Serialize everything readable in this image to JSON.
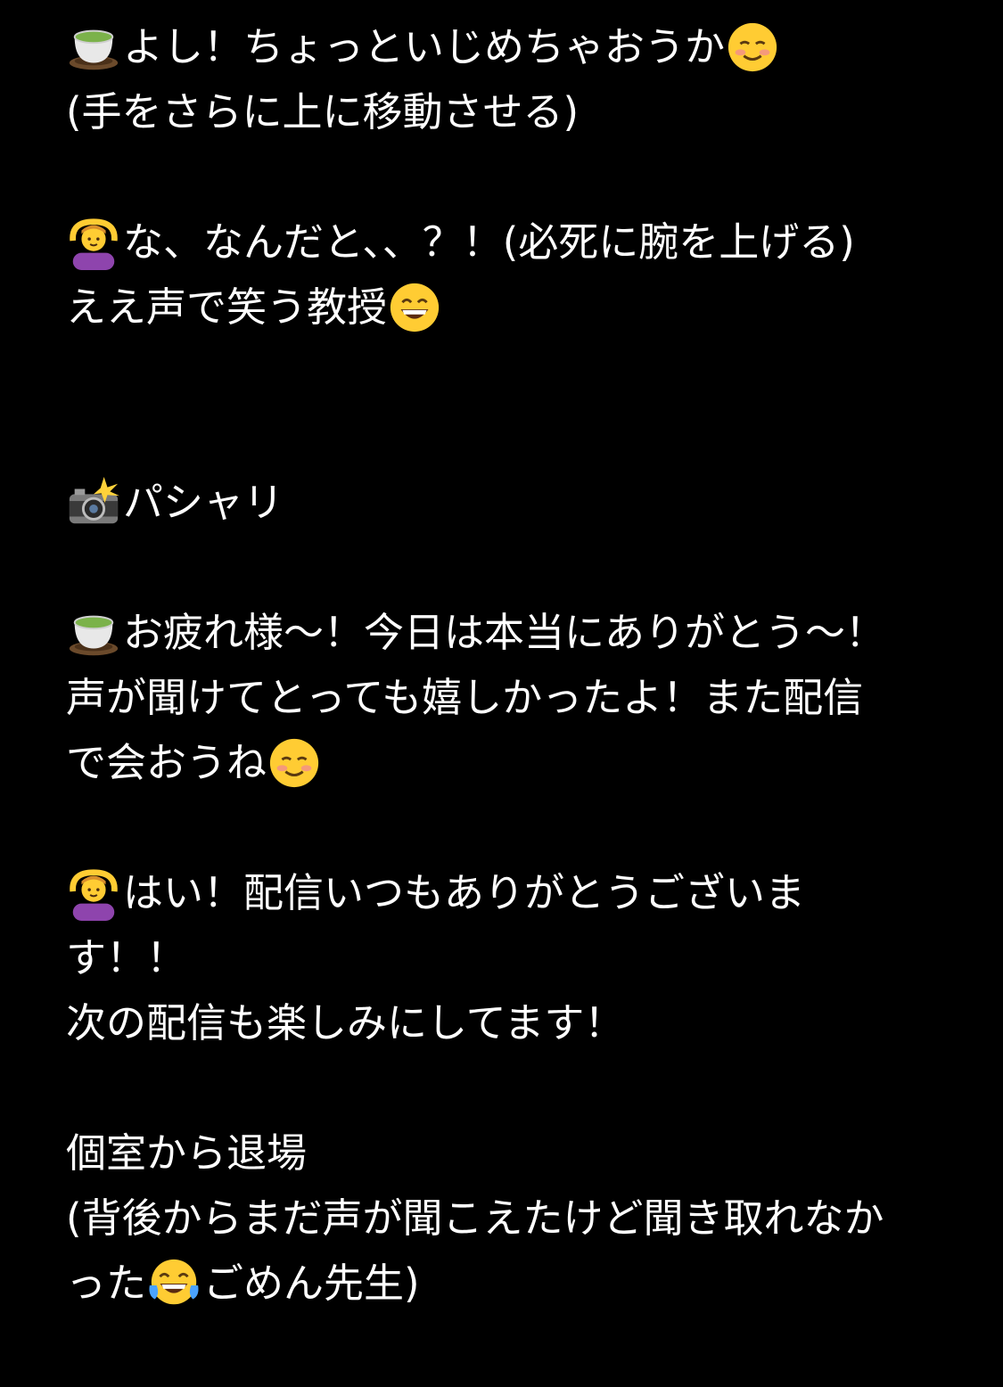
{
  "colors": {
    "background": "#000000",
    "text": "#ffffff"
  },
  "icons": {
    "tea": "teacup-emoji-icon",
    "woman": "woman-gesturing-ok-emoji-icon",
    "smile": "smiling-face-emoji-icon",
    "grin": "grinning-face-emoji-icon",
    "camera": "camera-with-flash-emoji-icon",
    "joy": "face-with-tears-of-joy-emoji-icon"
  },
  "lines": [
    "よし！ちょっといじめちゃおうか",
    "(手をさらに上に移動させる)",
    "な、なんだと、、？！(必死に腕を上げる)",
    "ええ声で笑う教授",
    "パシャリ",
    "お疲れ様〜！今日は本当にありがとう〜！",
    "声が聞けてとっても嬉しかったよ！また配信",
    "で会おうね",
    "はい！配信いつもありがとうございま",
    "す！！",
    "次の配信も楽しみにしてます！",
    "個室から退場",
    "(背後からまだ声が聞こえたけど聞き取れなか",
    "った",
    "ごめん先生)"
  ]
}
